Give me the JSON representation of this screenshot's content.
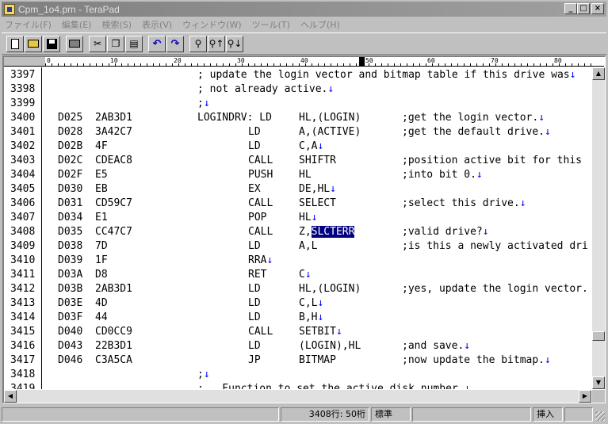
{
  "window": {
    "title": "Cpm_1o4.prn - TeraPad",
    "minimize": "_",
    "maximize": "□",
    "close": "×"
  },
  "menu": [
    "ファイル(F)",
    "編集(E)",
    "検索(S)",
    "表示(V)",
    "ウィンドウ(W)",
    "ツール(T)",
    "ヘルプ(H)"
  ],
  "toolbar": {
    "icons": [
      "new-file-icon",
      "open-folder-icon",
      "save-icon",
      "print-icon",
      "cut-icon",
      "copy-icon",
      "paste-icon",
      "undo-icon",
      "redo-icon",
      "find-icon",
      "find-next-icon",
      "find-prev-icon"
    ]
  },
  "ruler": [
    "0",
    "10",
    "20",
    "30",
    "40",
    "50",
    "60",
    "70",
    "80"
  ],
  "editor": {
    "return_mark": "↓",
    "lines": [
      {
        "n": "3397",
        "addr": "",
        "hex": "",
        "label": "; update the login vector and bitmap table if this drive was",
        "op": "",
        "arg": "",
        "cmt": "",
        "ret": true
      },
      {
        "n": "3398",
        "addr": "",
        "hex": "",
        "label": "; not already active.",
        "op": "",
        "arg": "",
        "cmt": "",
        "ret": true
      },
      {
        "n": "3399",
        "addr": "",
        "hex": "",
        "label": ";",
        "op": "",
        "arg": "",
        "cmt": "",
        "ret": true
      },
      {
        "n": "3400",
        "addr": "D025",
        "hex": "2AB3D1",
        "label": "LOGINDRV: LD",
        "op": "",
        "arg": "HL,(LOGIN)",
        "cmt": ";get the login vector.",
        "ret": true
      },
      {
        "n": "3401",
        "addr": "D028",
        "hex": "3A42C7",
        "label": "",
        "op": "LD",
        "arg": "A,(ACTIVE)",
        "cmt": ";get the default drive.",
        "ret": true
      },
      {
        "n": "3402",
        "addr": "D02B",
        "hex": "4F",
        "label": "",
        "op": "LD",
        "arg": "C,A",
        "cmt": "",
        "ret": true
      },
      {
        "n": "3403",
        "addr": "D02C",
        "hex": "CDEAC8",
        "label": "",
        "op": "CALL",
        "arg": "SHIFTR",
        "cmt": ";position active bit for this",
        "ret": false
      },
      {
        "n": "3404",
        "addr": "D02F",
        "hex": "E5",
        "label": "",
        "op": "PUSH",
        "arg": "HL",
        "cmt": ";into bit 0.",
        "ret": true
      },
      {
        "n": "3405",
        "addr": "D030",
        "hex": "EB",
        "label": "",
        "op": "EX",
        "arg": "DE,HL",
        "cmt": "",
        "ret": true
      },
      {
        "n": "3406",
        "addr": "D031",
        "hex": "CD59C7",
        "label": "",
        "op": "CALL",
        "arg": "SELECT",
        "cmt": ";select this drive.",
        "ret": true
      },
      {
        "n": "3407",
        "addr": "D034",
        "hex": "E1",
        "label": "",
        "op": "POP",
        "arg": "HL",
        "cmt": "",
        "ret": true
      },
      {
        "n": "3408",
        "addr": "D035",
        "hex": "CC47C7",
        "label": "",
        "op": "CALL",
        "arg": "Z,",
        "arg_sel": "SLCTERR",
        "cmt": ";valid drive?",
        "ret": true
      },
      {
        "n": "3409",
        "addr": "D038",
        "hex": "7D",
        "label": "",
        "op": "LD",
        "arg": "A,L",
        "cmt": ";is this a newly activated dri",
        "ret": false
      },
      {
        "n": "3410",
        "addr": "D039",
        "hex": "1F",
        "label": "",
        "op": "RRA",
        "arg": "",
        "cmt": "",
        "ret": true
      },
      {
        "n": "3411",
        "addr": "D03A",
        "hex": "D8",
        "label": "",
        "op": "RET",
        "arg": "C",
        "cmt": "",
        "ret": true
      },
      {
        "n": "3412",
        "addr": "D03B",
        "hex": "2AB3D1",
        "label": "",
        "op": "LD",
        "arg": "HL,(LOGIN)",
        "cmt": ";yes, update the login vector.",
        "ret": false
      },
      {
        "n": "3413",
        "addr": "D03E",
        "hex": "4D",
        "label": "",
        "op": "LD",
        "arg": "C,L",
        "cmt": "",
        "ret": true
      },
      {
        "n": "3414",
        "addr": "D03F",
        "hex": "44",
        "label": "",
        "op": "LD",
        "arg": "B,H",
        "cmt": "",
        "ret": true
      },
      {
        "n": "3415",
        "addr": "D040",
        "hex": "CD0CC9",
        "label": "",
        "op": "CALL",
        "arg": "SETBIT",
        "cmt": "",
        "ret": true
      },
      {
        "n": "3416",
        "addr": "D043",
        "hex": "22B3D1",
        "label": "",
        "op": "LD",
        "arg": "(LOGIN),HL",
        "cmt": ";and save.",
        "ret": true
      },
      {
        "n": "3417",
        "addr": "D046",
        "hex": "C3A5CA",
        "label": "",
        "op": "JP",
        "arg": "BITMAP",
        "cmt": ";now update the bitmap.",
        "ret": true
      },
      {
        "n": "3418",
        "addr": "",
        "hex": "",
        "label": ";",
        "op": "",
        "arg": "",
        "cmt": "",
        "ret": true
      },
      {
        "n": "3419",
        "addr": "",
        "hex": "",
        "label": ";   Function to set the active disk number.",
        "op": "",
        "arg": "",
        "cmt": "",
        "ret": true
      }
    ]
  },
  "statusbar": {
    "position": "3408行:  50桁",
    "encoding": "標準",
    "mode": "挿入"
  }
}
